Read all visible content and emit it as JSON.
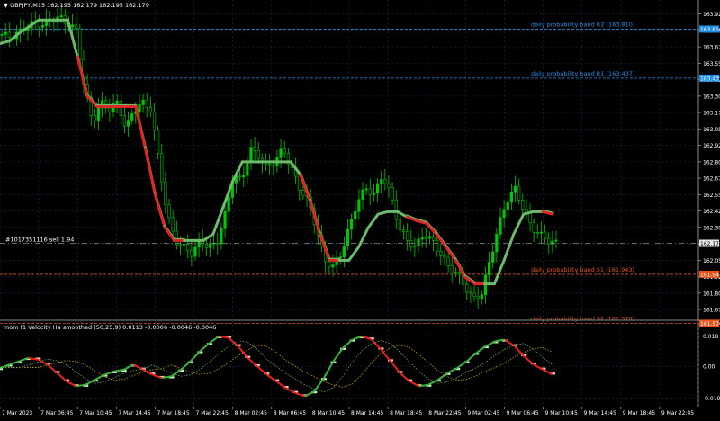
{
  "header": {
    "symbol_line": "▼ GBPJPY,M15  162.195 162.179 162.195 162.179"
  },
  "order_label": "#1017351116 sell 1.94",
  "bands": [
    {
      "name": "R2",
      "label": "daily probability band R2 (163.810)",
      "price": 163.81,
      "tag": "163.810",
      "color": "#1e8fe6"
    },
    {
      "name": "R1",
      "label": "daily probability band R1 (163.437)",
      "price": 163.437,
      "tag": "163.437",
      "color": "#1e8fe6"
    },
    {
      "name": "S1",
      "label": "daily probability band S1 (161.943)",
      "price": 161.943,
      "tag": "161.943",
      "color": "#e8541a"
    },
    {
      "name": "S2",
      "label": "daily probability band S2 (161.570)",
      "price": 161.57,
      "tag": "161.570",
      "color": "#e8541a"
    }
  ],
  "current_price": {
    "value": 162.179,
    "tag": "162.179"
  },
  "price_axis": {
    "ticks": [
      "163.925",
      "163.800",
      "163.675",
      "163.550",
      "163.425",
      "163.300",
      "163.175",
      "163.050",
      "162.925",
      "162.800",
      "162.675",
      "162.550",
      "162.425",
      "162.300",
      "162.175",
      "162.050",
      "161.925",
      "161.800",
      "161.675"
    ],
    "min": 161.6,
    "max": 163.95
  },
  "time_axis": {
    "labels": [
      "7 Mar 2023",
      "7 Mar 06:45",
      "7 Mar 10:45",
      "7 Mar 14:45",
      "7 Mar 18:45",
      "7 Mar 22:45",
      "8 Mar 02:45",
      "8 Mar 06:45",
      "8 Mar 10:45",
      "8 Mar 14:45",
      "8 Mar 18:45",
      "8 Mar 22:45",
      "9 Mar 02:45",
      "9 Mar 06:45",
      "9 Mar 10:45",
      "9 Mar 14:45",
      "9 Mar 18:45",
      "9 Mar 22:45"
    ]
  },
  "indicator": {
    "title": "mom f1 Velocity Ha smoothed (50,25,9) 0.0113 -0.0006 -0.0046 -0.0046",
    "ticks": [
      "0.018",
      "0.00",
      "-0.019"
    ],
    "min": -0.022,
    "max": 0.02
  },
  "colors": {
    "background": "#000000",
    "grid": "#1c2a4a",
    "candle": "#00c800",
    "trend_up": "#6dba6d",
    "trend_down": "#e02424",
    "current_line": "#7a8a8a"
  },
  "chart_data": {
    "type": "line",
    "x_labels_first": "7 Mar 2023",
    "close": [
      163.77,
      163.75,
      163.78,
      163.83,
      163.86,
      163.84,
      163.88,
      163.9,
      163.85,
      163.8,
      163.35,
      163.1,
      163.25,
      163.2,
      163.25,
      163.05,
      163.2,
      163.25,
      163.2,
      162.8,
      162.4,
      162.2,
      162.15,
      162.1,
      162.2,
      162.15,
      162.18,
      162.4,
      162.7,
      162.65,
      162.9,
      162.85,
      162.75,
      162.8,
      162.9,
      162.75,
      162.6,
      162.5,
      162.3,
      162.05,
      162.0,
      162.1,
      162.3,
      162.5,
      162.6,
      162.55,
      162.7,
      162.55,
      162.3,
      162.2,
      162.15,
      162.25,
      162.2,
      162.1,
      162.0,
      161.95,
      161.85,
      161.75,
      161.8,
      162.05,
      162.3,
      162.5,
      162.6,
      162.45,
      162.3,
      162.25,
      162.2,
      162.18
    ],
    "trend": [
      163.7,
      163.72,
      163.78,
      163.83,
      163.88,
      163.88,
      163.88,
      163.88,
      163.6,
      163.3,
      163.22,
      163.22,
      163.22,
      163.22,
      163.22,
      162.9,
      162.55,
      162.3,
      162.2,
      162.2,
      162.2,
      162.2,
      162.25,
      162.45,
      162.65,
      162.8,
      162.8,
      162.8,
      162.8,
      162.8,
      162.8,
      162.7,
      162.5,
      162.25,
      162.05,
      162.05,
      162.05,
      162.15,
      162.3,
      162.4,
      162.42,
      162.42,
      162.38,
      162.35,
      162.33,
      162.25,
      162.15,
      162.05,
      161.92,
      161.87,
      161.87,
      161.87,
      162.05,
      162.25,
      162.4,
      162.42,
      162.42,
      162.4
    ],
    "trend_dir": [
      1,
      1,
      1,
      1,
      1,
      1,
      1,
      1,
      -1,
      -1,
      -1,
      -1,
      -1,
      -1,
      -1,
      -1,
      -1,
      -1,
      -1,
      1,
      1,
      1,
      1,
      1,
      1,
      1,
      1,
      1,
      1,
      1,
      1,
      -1,
      -1,
      -1,
      -1,
      1,
      1,
      1,
      1,
      1,
      1,
      1,
      -1,
      -1,
      -1,
      -1,
      -1,
      -1,
      -1,
      -1,
      1,
      1,
      1,
      1,
      1,
      1,
      -1,
      -1
    ],
    "velocity": [
      -0.001,
      0.001,
      0.003,
      0.005,
      0.004,
      0.001,
      -0.004,
      -0.009,
      -0.012,
      -0.011,
      -0.008,
      -0.005,
      -0.003,
      -0.002,
      0.001,
      -0.002,
      -0.005,
      -0.007,
      -0.006,
      -0.002,
      0.003,
      0.009,
      0.014,
      0.018,
      0.017,
      0.012,
      0.005,
      0.0,
      -0.005,
      -0.009,
      -0.013,
      -0.016,
      -0.018,
      -0.015,
      -0.007,
      0.003,
      0.011,
      0.016,
      0.018,
      0.016,
      0.01,
      0.003,
      -0.004,
      -0.009,
      -0.012,
      -0.011,
      -0.008,
      -0.004,
      -0.001,
      0.003,
      0.008,
      0.012,
      0.015,
      0.016,
      0.012,
      0.006,
      0.001,
      -0.002,
      -0.005
    ],
    "ylim": [
      161.6,
      163.95
    ]
  }
}
